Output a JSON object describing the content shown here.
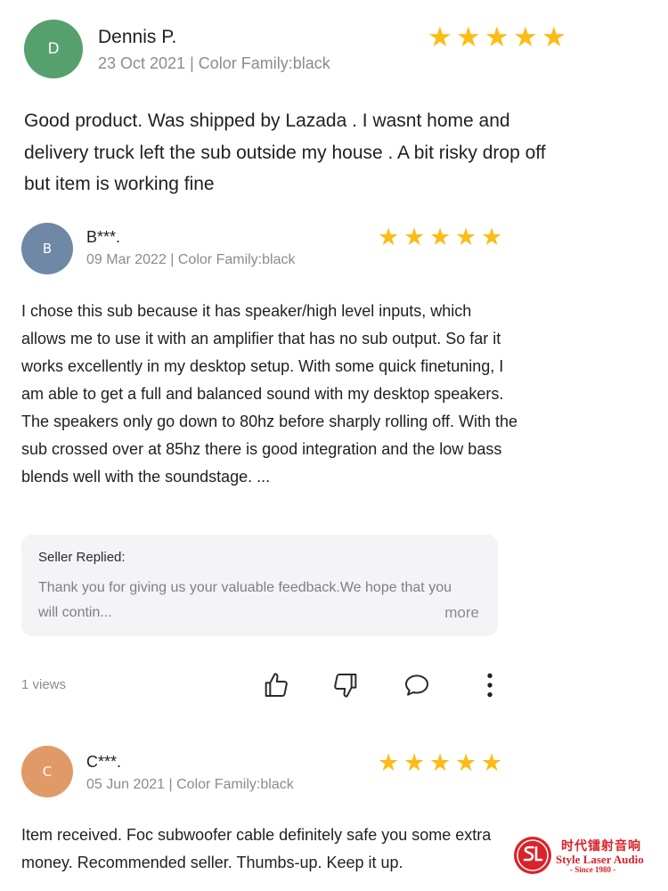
{
  "reviews": [
    {
      "avatar_letter": "D",
      "avatar_color": "#55a06c",
      "name": "Dennis P.",
      "meta": "23 Oct 2021 | Color Family:black",
      "rating": 5,
      "text": "Good product. Was shipped by Lazada . I wasnt home and delivery truck left the sub outside my house . A bit risky drop off but item is working fine"
    },
    {
      "avatar_letter": "B",
      "avatar_color": "#6e88a6",
      "name": "B***.",
      "meta": "09 Mar 2022 | Color Family:black",
      "rating": 5,
      "text": "I chose this sub because it has speaker/high level inputs, which allows me to use it with an amplifier that has no sub output. So far it works excellently in my desktop setup. With some quick finetuning, I am able to get a full and balanced sound with my desktop speakers. The speakers only go down to 80hz before sharply rolling off. With the sub crossed over at 85hz there is good integration and the low bass blends well with the soundstage. ...",
      "seller_reply": {
        "title": "Seller Replied:",
        "text": "Thank you for giving us your valuable feedback.We hope that you will contin...",
        "more_label": "more"
      },
      "views": "1 views",
      "actions": {
        "like_icon": "thumbs-up-icon",
        "dislike_icon": "thumbs-down-icon",
        "comment_icon": "comment-icon",
        "more_icon": "more-vertical-icon"
      }
    },
    {
      "avatar_letter": "C",
      "avatar_color": "#e09a68",
      "name": "C***.",
      "meta": "05 Jun 2021 | Color Family:black",
      "rating": 5,
      "text": "Item received. Foc subwoofer cable definitely safe you some extra money. Recommended seller. Thumbs-up. Keep it up."
    }
  ],
  "star_color": "#fbbc16",
  "watermark": {
    "logo_text": "SL",
    "chinese": "时代镭射音响",
    "english": "Style Laser Audio",
    "since": "- Since 1980 -",
    "color": "#d8232a"
  }
}
